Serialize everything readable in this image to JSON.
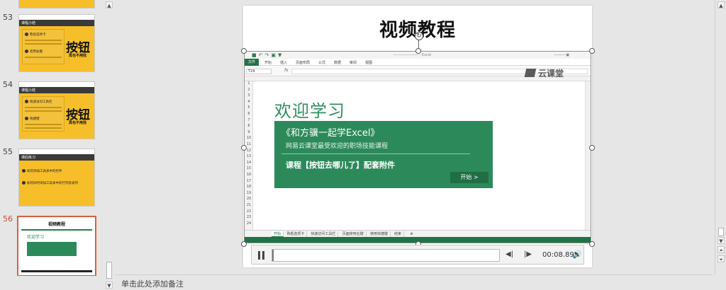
{
  "thumbnails": [
    {
      "number": "53",
      "bar_title": "课程小结",
      "items": [
        "熟悉选项卡",
        "适用右键"
      ],
      "big": "按钮",
      "small": "再也不用找"
    },
    {
      "number": "54",
      "bar_title": "课程小结",
      "items": [
        "快速访问工具栏",
        "快捷键"
      ],
      "big": "按钮",
      "small": "再也不用找"
    },
    {
      "number": "55",
      "bar_title": "课后练习",
      "items": [
        "如何添加工具表中的控件",
        "如何同时添加工具表中的行列及表列"
      ]
    },
    {
      "number": "56",
      "title": "视频教程",
      "welcome": "欢迎学习",
      "active": true
    }
  ],
  "slide": {
    "title": "视频教程"
  },
  "video": {
    "excel": {
      "file_tab": "文件",
      "tabs": [
        "开始",
        "插入",
        "页面布局",
        "公式",
        "数据",
        "审阅",
        "视图"
      ],
      "name_box": "T24",
      "fx": "fx",
      "row_numbers": [
        "1",
        "2",
        "3",
        "4",
        "5",
        "6",
        "7",
        "8",
        "9",
        "10",
        "11",
        "12",
        "13",
        "14",
        "15",
        "16",
        "17",
        "18",
        "19",
        "20",
        "21",
        "22",
        "23",
        "24"
      ],
      "sheet_tabs": [
        "开始",
        "熟悉选项卡",
        "快速访问工具栏",
        "页面使用右键",
        "使用快捷键",
        "结束"
      ],
      "add_sheet": "⊕"
    },
    "logo_text": "云课堂",
    "welcome": "欢迎学习",
    "course_title": "《和方骥一起学Excel》",
    "subtitle": "网易云课堂最受欢迎的职场技能课程",
    "course_line": "课程【按钮去哪儿了】配套附件",
    "start_button": "开始 >"
  },
  "media": {
    "time": "00:08.89",
    "progress": 0.005,
    "back_icon": "step-back-icon",
    "forward_icon": "step-forward-icon",
    "volume_icon": "volume-icon"
  },
  "notes": {
    "placeholder": "单击此处添加备注"
  }
}
